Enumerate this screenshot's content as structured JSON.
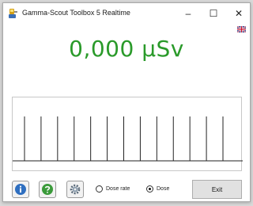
{
  "window": {
    "title": "Gamma-Scout Toolbox 5 Realtime",
    "controls": {
      "minimize": "–",
      "maximize": "☐",
      "close": "✕"
    }
  },
  "language_flag_icon": "uk-flag-icon",
  "reading": {
    "value": "0,000 µSv",
    "color": "#2a9a2a"
  },
  "pulse_graph": {
    "pulse_count": 13
  },
  "toolbar": {
    "info_icon": "info-icon",
    "help_icon": "help-icon",
    "settings_icon": "gear-icon",
    "mode_options": [
      {
        "label": "Dose rate",
        "selected": false
      },
      {
        "label": "Dose",
        "selected": true
      }
    ],
    "exit_label": "Exit"
  }
}
